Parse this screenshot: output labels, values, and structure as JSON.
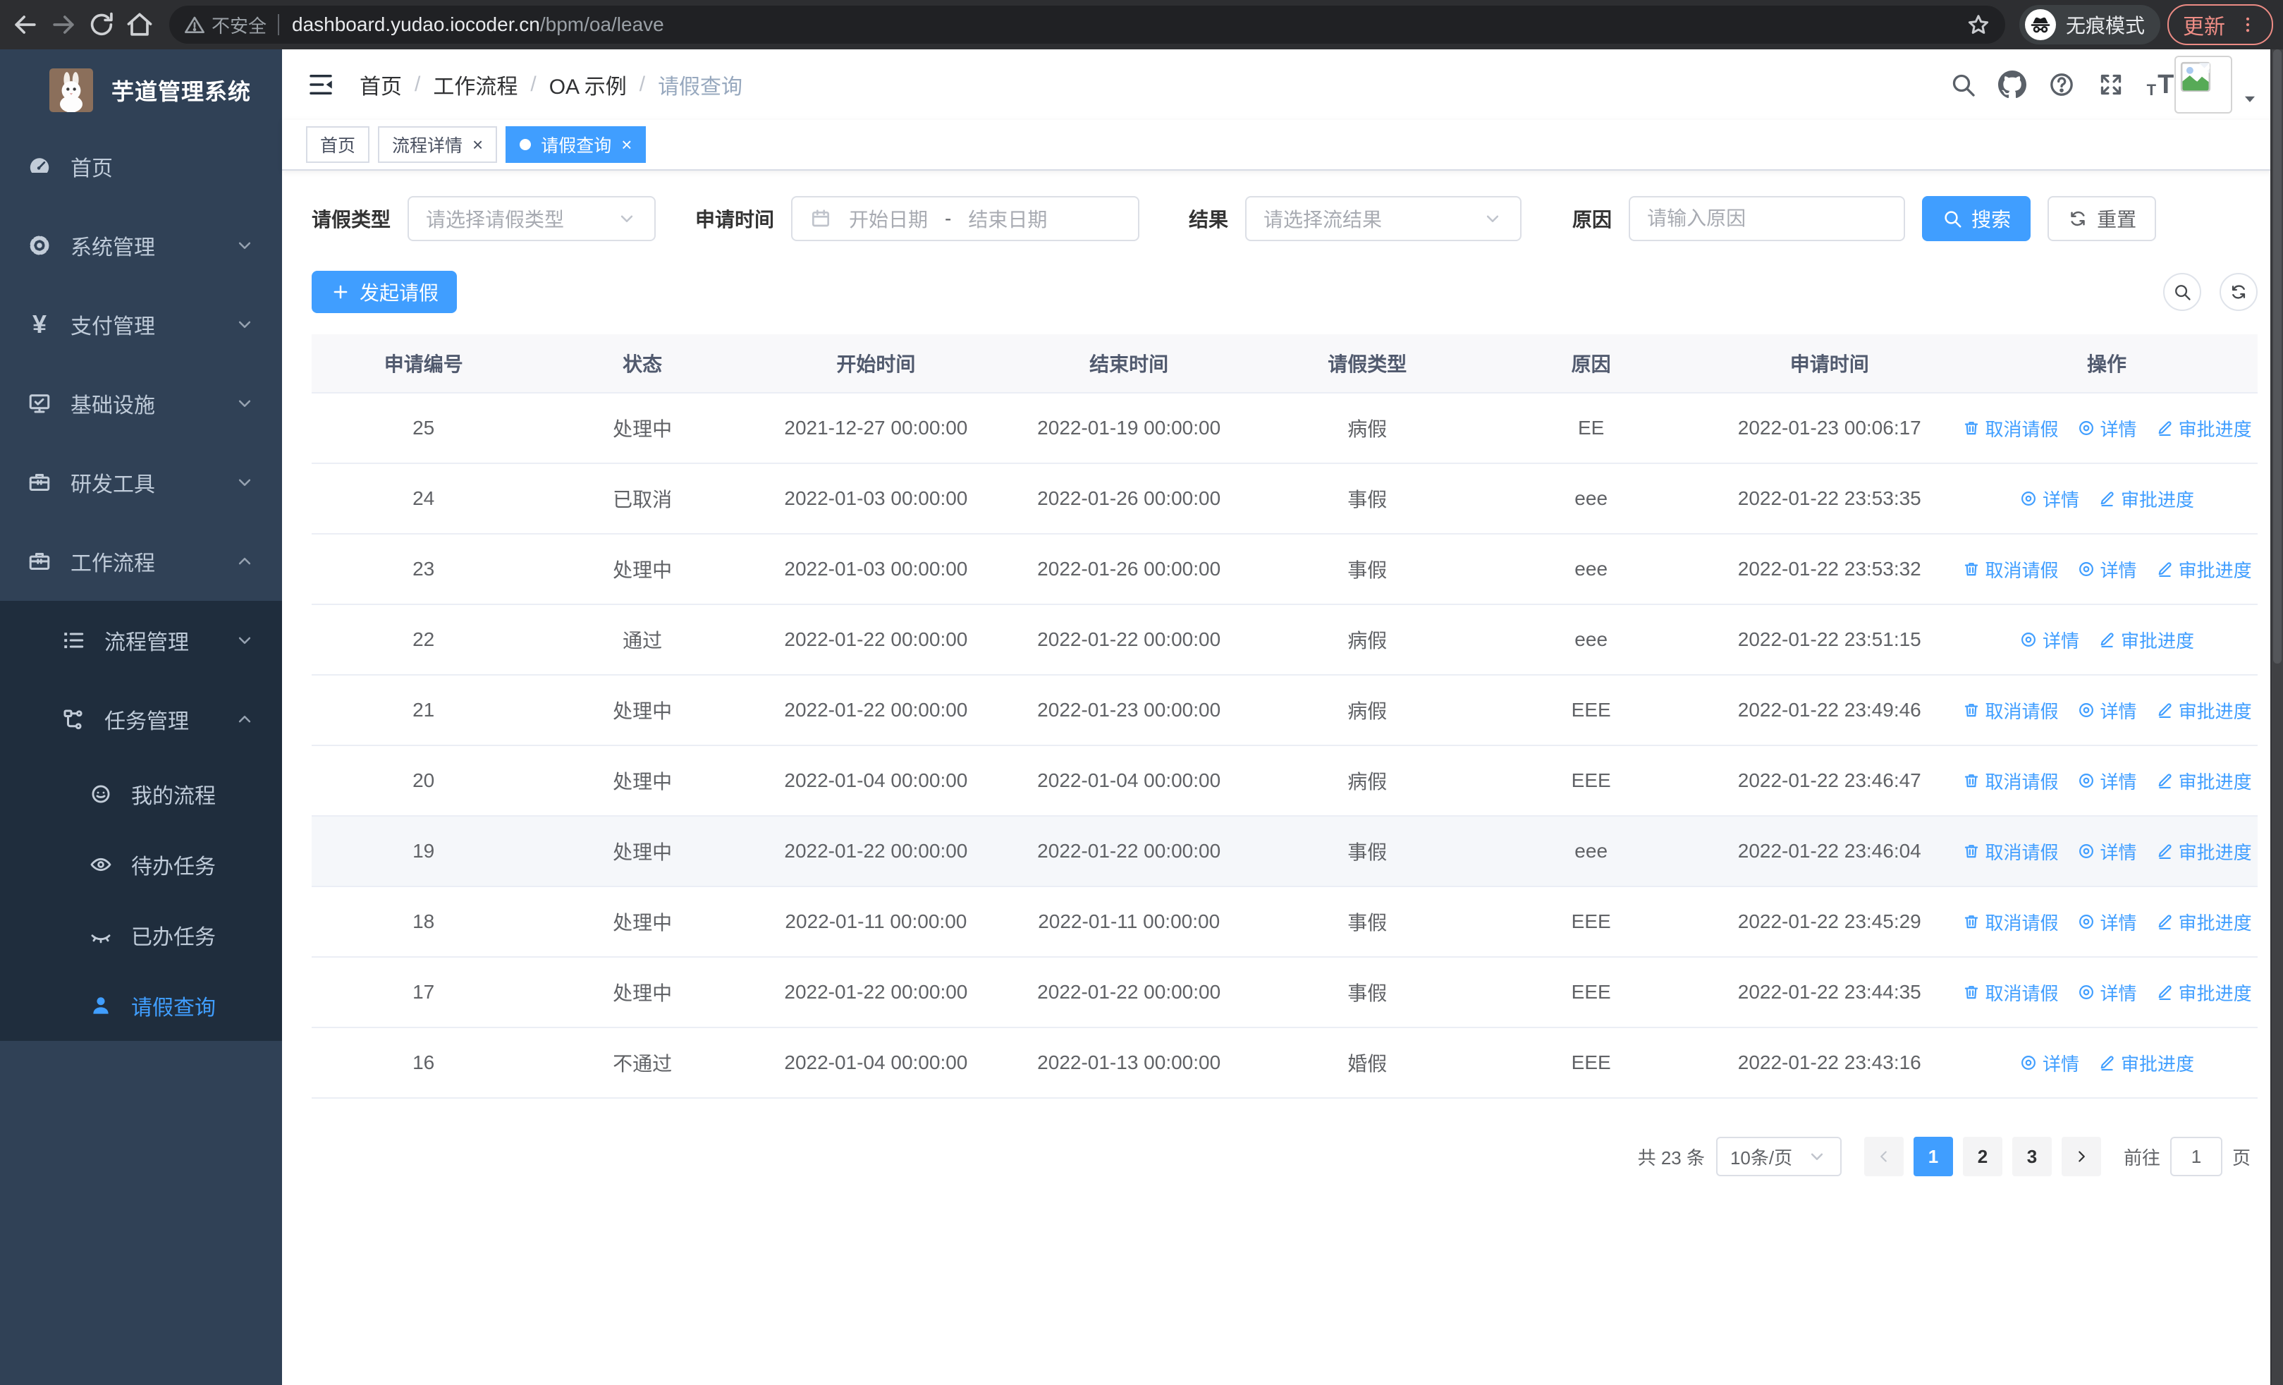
{
  "colors": {
    "primary": "#409eff",
    "sidebar_bg": "#304156",
    "sidebar_submenu_bg": "#1f2d3d",
    "update_badge": "#ee8d85"
  },
  "browser": {
    "security_label": "不安全",
    "url_host": "dashboard.yudao.iocoder.cn",
    "url_path": "/bpm/oa/leave",
    "incognito_label": "无痕模式",
    "update_label": "更新"
  },
  "sidebar": {
    "title": "芋道管理系统",
    "items": [
      {
        "key": "home",
        "label": "首页",
        "icon": "dashboard-icon",
        "level": 1
      },
      {
        "key": "system",
        "label": "系统管理",
        "icon": "gear-icon",
        "level": 1,
        "chevron": "down"
      },
      {
        "key": "payment",
        "label": "支付管理",
        "icon": "yen-icon",
        "level": 1,
        "chevron": "down"
      },
      {
        "key": "infrastructure",
        "label": "基础设施",
        "icon": "monitor-icon",
        "level": 1,
        "chevron": "down"
      },
      {
        "key": "dev-tools",
        "label": "研发工具",
        "icon": "toolbox-icon",
        "level": 1,
        "chevron": "down"
      },
      {
        "key": "workflow",
        "label": "工作流程",
        "icon": "toolbox-icon",
        "level": 1,
        "chevron": "up"
      },
      {
        "key": "process-mgmt",
        "label": "流程管理",
        "icon": "list-icon",
        "level": 2,
        "chevron": "down",
        "submenu": true
      },
      {
        "key": "task-mgmt",
        "label": "任务管理",
        "icon": "tree-icon",
        "level": 2,
        "chevron": "up",
        "submenu": true
      },
      {
        "key": "my-process",
        "label": "我的流程",
        "icon": "face-icon",
        "level": 3,
        "submenu": true
      },
      {
        "key": "todo-tasks",
        "label": "待办任务",
        "icon": "eye-open-icon",
        "level": 3,
        "submenu": true
      },
      {
        "key": "done-tasks",
        "label": "已办任务",
        "icon": "eye-closed-icon",
        "level": 3,
        "submenu": true
      },
      {
        "key": "leave-query",
        "label": "请假查询",
        "icon": "user-icon",
        "level": 3,
        "submenu": true,
        "active": true
      }
    ]
  },
  "breadcrumb": {
    "items": [
      "首页",
      "工作流程",
      "OA 示例",
      "请假查询"
    ]
  },
  "header": {
    "icons": [
      "search-icon",
      "github-icon",
      "question-icon",
      "fullscreen-icon",
      "font-size-icon"
    ]
  },
  "tabs": [
    {
      "key": "home",
      "label": "首页",
      "closable": false,
      "active": false
    },
    {
      "key": "process-detail",
      "label": "流程详情",
      "closable": true,
      "active": false
    },
    {
      "key": "leave-query",
      "label": "请假查询",
      "closable": true,
      "active": true
    }
  ],
  "filters": {
    "leave_type": {
      "label": "请假类型",
      "placeholder": "请选择请假类型"
    },
    "apply_time": {
      "label": "申请时间",
      "start_placeholder": "开始日期",
      "separator": "-",
      "end_placeholder": "结束日期"
    },
    "result": {
      "label": "结果",
      "placeholder": "请选择流结果"
    },
    "reason": {
      "label": "原因",
      "placeholder": "请输入原因"
    },
    "search_label": "搜索",
    "reset_label": "重置"
  },
  "toolbar": {
    "create_label": "发起请假"
  },
  "table": {
    "columns": [
      "申请编号",
      "状态",
      "开始时间",
      "结束时间",
      "请假类型",
      "原因",
      "申请时间",
      "操作"
    ],
    "action_labels": {
      "cancel": "取消请假",
      "detail": "详情",
      "progress": "审批进度"
    },
    "rows": [
      {
        "id": "25",
        "status": "处理中",
        "start_time": "2021-12-27 00:00:00",
        "end_time": "2022-01-19 00:00:00",
        "leave_type": "病假",
        "reason": "EE",
        "apply_time": "2022-01-23 00:06:17",
        "can_cancel": true,
        "highlighted": false
      },
      {
        "id": "24",
        "status": "已取消",
        "start_time": "2022-01-03 00:00:00",
        "end_time": "2022-01-26 00:00:00",
        "leave_type": "事假",
        "reason": "eee",
        "apply_time": "2022-01-22 23:53:35",
        "can_cancel": false,
        "highlighted": false
      },
      {
        "id": "23",
        "status": "处理中",
        "start_time": "2022-01-03 00:00:00",
        "end_time": "2022-01-26 00:00:00",
        "leave_type": "事假",
        "reason": "eee",
        "apply_time": "2022-01-22 23:53:32",
        "can_cancel": true,
        "highlighted": false
      },
      {
        "id": "22",
        "status": "通过",
        "start_time": "2022-01-22 00:00:00",
        "end_time": "2022-01-22 00:00:00",
        "leave_type": "病假",
        "reason": "eee",
        "apply_time": "2022-01-22 23:51:15",
        "can_cancel": false,
        "highlighted": false
      },
      {
        "id": "21",
        "status": "处理中",
        "start_time": "2022-01-22 00:00:00",
        "end_time": "2022-01-23 00:00:00",
        "leave_type": "病假",
        "reason": "EEE",
        "apply_time": "2022-01-22 23:49:46",
        "can_cancel": true,
        "highlighted": false
      },
      {
        "id": "20",
        "status": "处理中",
        "start_time": "2022-01-04 00:00:00",
        "end_time": "2022-01-04 00:00:00",
        "leave_type": "病假",
        "reason": "EEE",
        "apply_time": "2022-01-22 23:46:47",
        "can_cancel": true,
        "highlighted": false
      },
      {
        "id": "19",
        "status": "处理中",
        "start_time": "2022-01-22 00:00:00",
        "end_time": "2022-01-22 00:00:00",
        "leave_type": "事假",
        "reason": "eee",
        "apply_time": "2022-01-22 23:46:04",
        "can_cancel": true,
        "highlighted": true
      },
      {
        "id": "18",
        "status": "处理中",
        "start_time": "2022-01-11 00:00:00",
        "end_time": "2022-01-11 00:00:00",
        "leave_type": "事假",
        "reason": "EEE",
        "apply_time": "2022-01-22 23:45:29",
        "can_cancel": true,
        "highlighted": false
      },
      {
        "id": "17",
        "status": "处理中",
        "start_time": "2022-01-22 00:00:00",
        "end_time": "2022-01-22 00:00:00",
        "leave_type": "事假",
        "reason": "EEE",
        "apply_time": "2022-01-22 23:44:35",
        "can_cancel": true,
        "highlighted": false
      },
      {
        "id": "16",
        "status": "不通过",
        "start_time": "2022-01-04 00:00:00",
        "end_time": "2022-01-13 00:00:00",
        "leave_type": "婚假",
        "reason": "EEE",
        "apply_time": "2022-01-22 23:43:16",
        "can_cancel": false,
        "highlighted": false
      }
    ]
  },
  "pagination": {
    "total_label": "共 23 条",
    "page_size": "10条/页",
    "pages": [
      "1",
      "2",
      "3"
    ],
    "active_page": "1",
    "goto_label": "前往",
    "goto_value": "1",
    "page_suffix": "页"
  }
}
